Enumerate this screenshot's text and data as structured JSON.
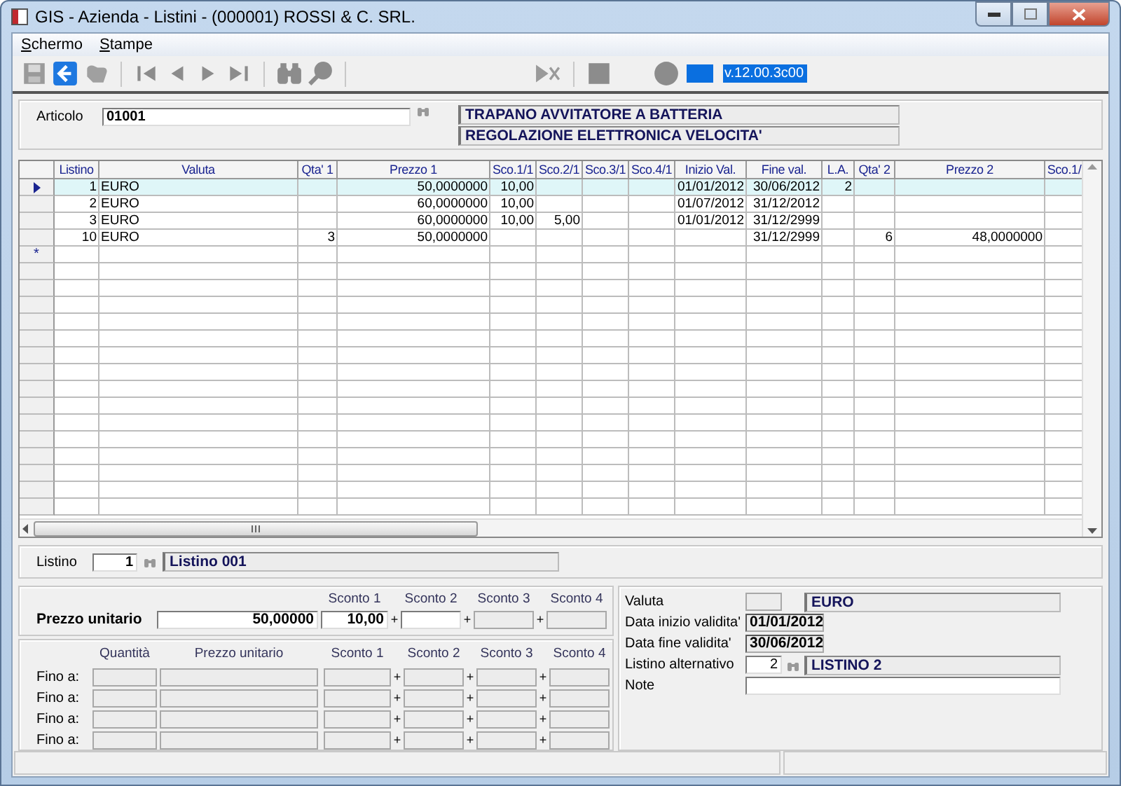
{
  "window": {
    "title": "GIS - Azienda - Listini - (000001) ROSSI & C. SRL."
  },
  "menu": [
    {
      "label": "Schermo"
    },
    {
      "label": "Stampe"
    }
  ],
  "toolbar": {
    "version": "v.12.00.3c00"
  },
  "article": {
    "label": "Articolo",
    "code": "01001",
    "description_lines": [
      "TRAPANO AVVITATORE A BATTERIA",
      "REGOLAZIONE ELETTRONICA VELOCITA'"
    ]
  },
  "grid": {
    "columns": [
      "Listino",
      "Valuta",
      "Qta' 1",
      "Prezzo 1",
      "Sco.1/1",
      "Sco.2/1",
      "Sco.3/1",
      "Sco.4/1",
      "Inizio Val.",
      "Fine val.",
      "L.A.",
      "Qta' 2",
      "Prezzo 2",
      "Sco.1/"
    ],
    "rows": [
      {
        "selected": true,
        "cells": [
          "1",
          "EURO",
          null,
          "50,0000000",
          "10,00",
          null,
          null,
          null,
          "01/01/2012",
          "30/06/2012",
          "2",
          null,
          null,
          null
        ]
      },
      {
        "selected": false,
        "cells": [
          "2",
          "EURO",
          null,
          "60,0000000",
          "10,00",
          null,
          null,
          null,
          "01/07/2012",
          "31/12/2012",
          null,
          null,
          null,
          null
        ]
      },
      {
        "selected": false,
        "cells": [
          "3",
          "EURO",
          null,
          "60,0000000",
          "10,00",
          "5,00",
          null,
          null,
          "01/01/2012",
          "31/12/2999",
          null,
          null,
          null,
          null
        ]
      },
      {
        "selected": false,
        "cells": [
          "10",
          "EURO",
          "3",
          "50,0000000",
          null,
          null,
          null,
          null,
          null,
          "31/12/2999",
          null,
          "6",
          "48,0000000",
          null
        ]
      }
    ],
    "new_row_marker": "*"
  },
  "listino": {
    "label": "Listino",
    "code": "1",
    "description": "Listino 001"
  },
  "price": {
    "label": "Prezzo unitario",
    "value": "50,00000",
    "discounts": [
      {
        "header": "Sconto 1",
        "value": "10,00",
        "disabled": false
      },
      {
        "header": "Sconto 2",
        "plus": "+",
        "disabled": false
      },
      {
        "header": "Sconto 3",
        "plus": "+",
        "disabled": true
      },
      {
        "header": "Sconto 4",
        "plus": "+",
        "disabled": true
      }
    ]
  },
  "tiers": {
    "headers": [
      "Quantità",
      "Prezzo unitario",
      "Sconto 1",
      "Sconto 2",
      "Sconto 3",
      "Sconto 4"
    ],
    "rows": [
      {
        "label": "Fino a:",
        "disabled": true,
        "plus": [
          "+",
          "+",
          "+"
        ]
      },
      {
        "label": "Fino a:",
        "disabled": true,
        "plus": [
          "+",
          "+",
          "+"
        ]
      },
      {
        "label": "Fino a:",
        "disabled": true,
        "plus": [
          "+",
          "+",
          "+"
        ]
      },
      {
        "label": "Fino a:",
        "disabled": true,
        "plus": [
          "+",
          "+",
          "+"
        ]
      }
    ]
  },
  "details": [
    {
      "kind": "code_desc",
      "label": "Valuta",
      "desc": "EURO"
    },
    {
      "kind": "date",
      "label": "Data inizio validita'",
      "value": "01/01/2012"
    },
    {
      "kind": "date",
      "label": "Data fine validita'",
      "value": "30/06/2012"
    },
    {
      "kind": "lookup",
      "label": "Listino alternativo",
      "value": "2",
      "desc": "LISTINO 2"
    },
    {
      "kind": "text",
      "label": "Note"
    }
  ]
}
